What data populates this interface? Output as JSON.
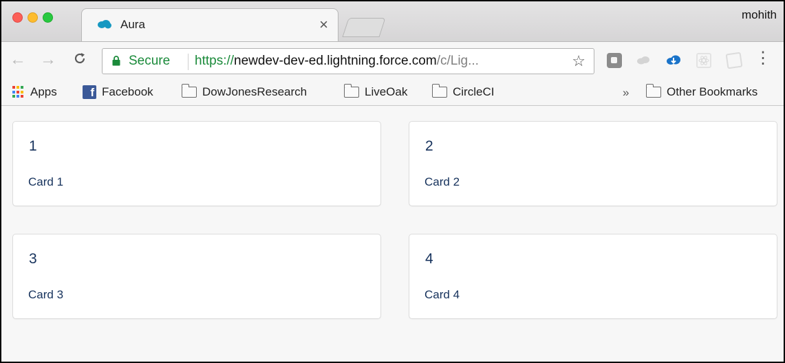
{
  "window": {
    "profile_name": "mohith",
    "tab": {
      "title": "Aura",
      "close": "×",
      "favicon": "salesforce-cloud-icon"
    }
  },
  "toolbar": {
    "back": "←",
    "forward": "→",
    "reload": "C",
    "omnibox": {
      "secure_label": "Secure",
      "url_scheme": "https://",
      "url_host": "newdev-dev-ed.lightning.force.com",
      "url_path": "/c/Lig...",
      "bookmark_star": "☆"
    },
    "extensions": [
      "square-extension-icon",
      "cloud-extension-icon",
      "cloud-download-icon",
      "react-devtools-icon",
      "notes-extension-icon"
    ],
    "menu": "⋮"
  },
  "bookmarks": {
    "apps": "Apps",
    "items": [
      "Facebook",
      "DowJonesResearch",
      "LiveOak",
      "CircleCI"
    ],
    "overflow": "»",
    "other": "Other Bookmarks"
  },
  "cards": [
    {
      "title": "1",
      "body": "Card 1"
    },
    {
      "title": "2",
      "body": "Card 2"
    },
    {
      "title": "3",
      "body": "Card 3"
    },
    {
      "title": "4",
      "body": "Card 4"
    }
  ],
  "colors": {
    "secure_green": "#1a8a3a",
    "card_text": "#16325c",
    "salesforce_blue": "#1798c1",
    "facebook_blue": "#3b5998"
  }
}
